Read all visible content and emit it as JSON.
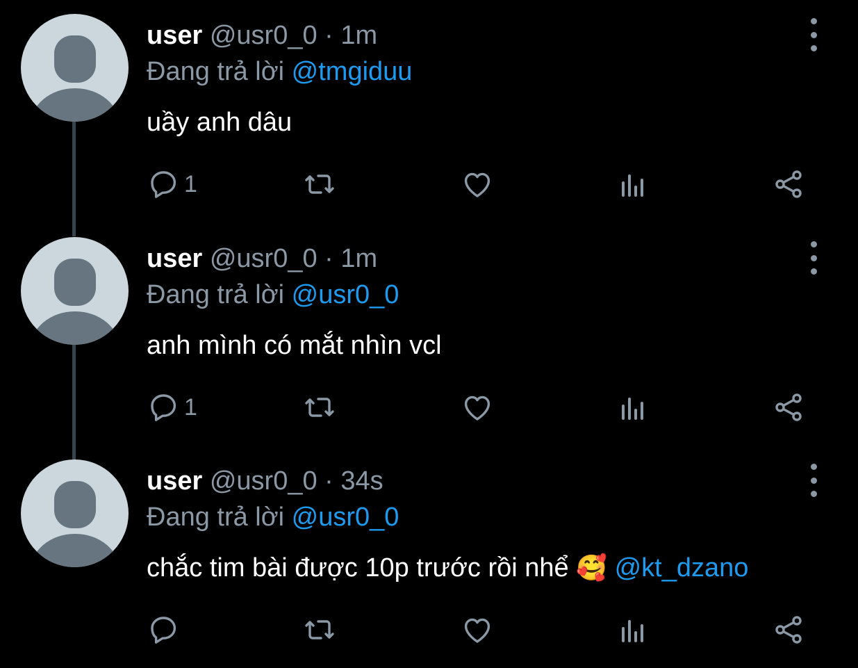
{
  "tweets": [
    {
      "display_name": "user",
      "handle": "@usr0_0",
      "separator": "·",
      "time": "1m",
      "replying_prefix": "Đang trả lời",
      "replying_to": "@tmgiduu",
      "text": "uầy anh dâu",
      "emoji": "",
      "mention": "",
      "reply_count": "1"
    },
    {
      "display_name": "user",
      "handle": "@usr0_0",
      "separator": "·",
      "time": "1m",
      "replying_prefix": "Đang trả lời",
      "replying_to": "@usr0_0",
      "text": "anh mình có mắt nhìn vcl",
      "emoji": "",
      "mention": "",
      "reply_count": "1"
    },
    {
      "display_name": "user",
      "handle": "@usr0_0",
      "separator": "·",
      "time": "34s",
      "replying_prefix": "Đang trả lời",
      "replying_to": "@usr0_0",
      "text": "chắc tim bài được 10p trước rồi nhể",
      "emoji": "🥰",
      "mention": "@kt_dzano",
      "reply_count": ""
    }
  ],
  "icons": {
    "reply": "reply-icon",
    "retweet": "retweet-icon",
    "like": "heart-icon",
    "analytics": "analytics-icon",
    "share": "share-icon",
    "more": "more-vertical-icon"
  },
  "colors": {
    "background": "#000000",
    "text": "#ffffff",
    "secondary": "#8b98a5",
    "link": "#1d9bf0",
    "thread_line": "#38444d",
    "avatar_bg": "#ccd6dd",
    "avatar_fg": "#66757f"
  }
}
